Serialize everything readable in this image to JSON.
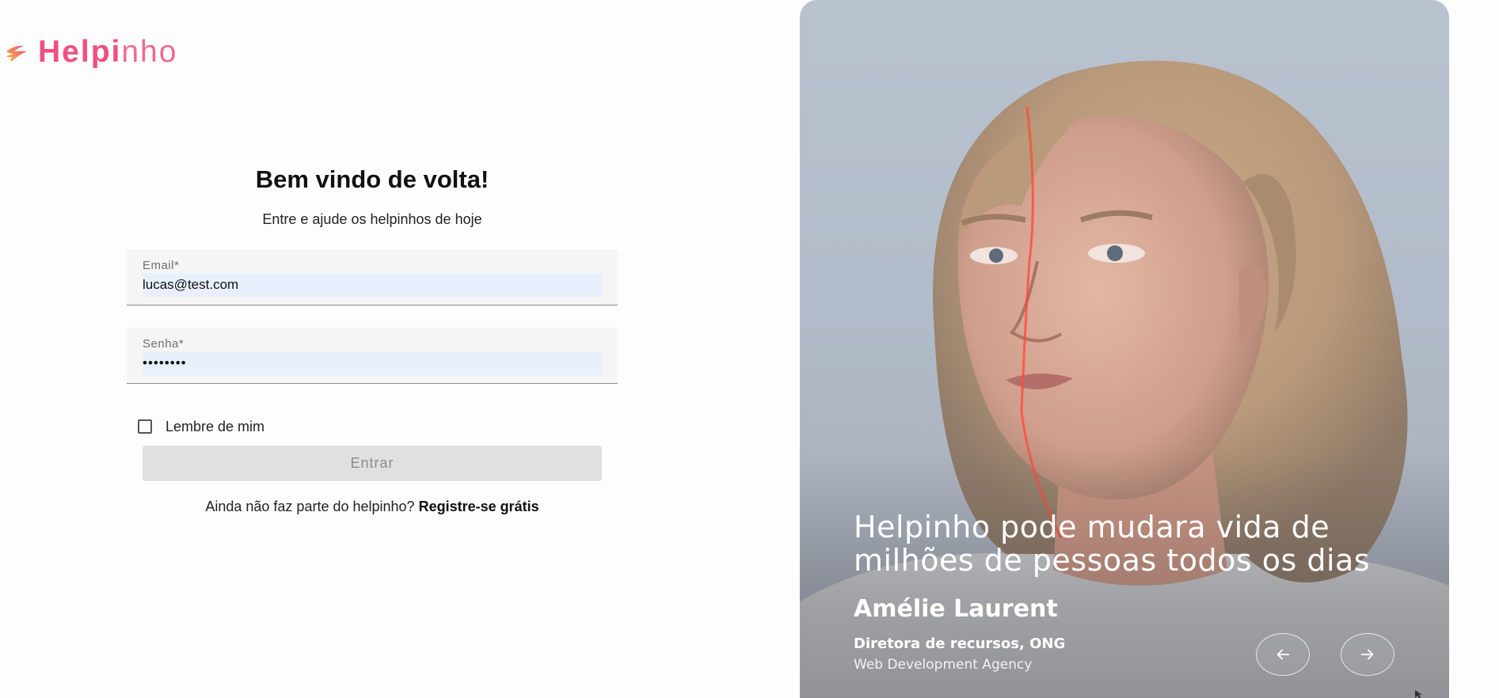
{
  "brand": {
    "name_strong": "Helpi",
    "name_light": "nho",
    "logo_icon": "helping-hand-icon",
    "accent_color": "#ef4f7e"
  },
  "login": {
    "title": "Bem vindo de volta!",
    "subtitle": "Entre e ajude os helpinhos de hoje",
    "email": {
      "label": "Email*",
      "value": "lucas@test.com"
    },
    "password": {
      "label": "Senha*",
      "value": "••••••••"
    },
    "remember_label": "Lembre de mim",
    "remember_checked": false,
    "submit_label": "Entrar",
    "signup_prompt": "Ainda não faz parte do helpinho?",
    "signup_link": "Registre-se grátis"
  },
  "hero": {
    "quote": "Helpinho pode mudara vida de milhões de pessoas todos os dias",
    "author_name": "Amélie Laurent",
    "author_role": "Diretora de recursos, ONG",
    "author_company": "Web Development Agency",
    "prev_icon": "arrow-left-icon",
    "next_icon": "arrow-right-icon"
  }
}
